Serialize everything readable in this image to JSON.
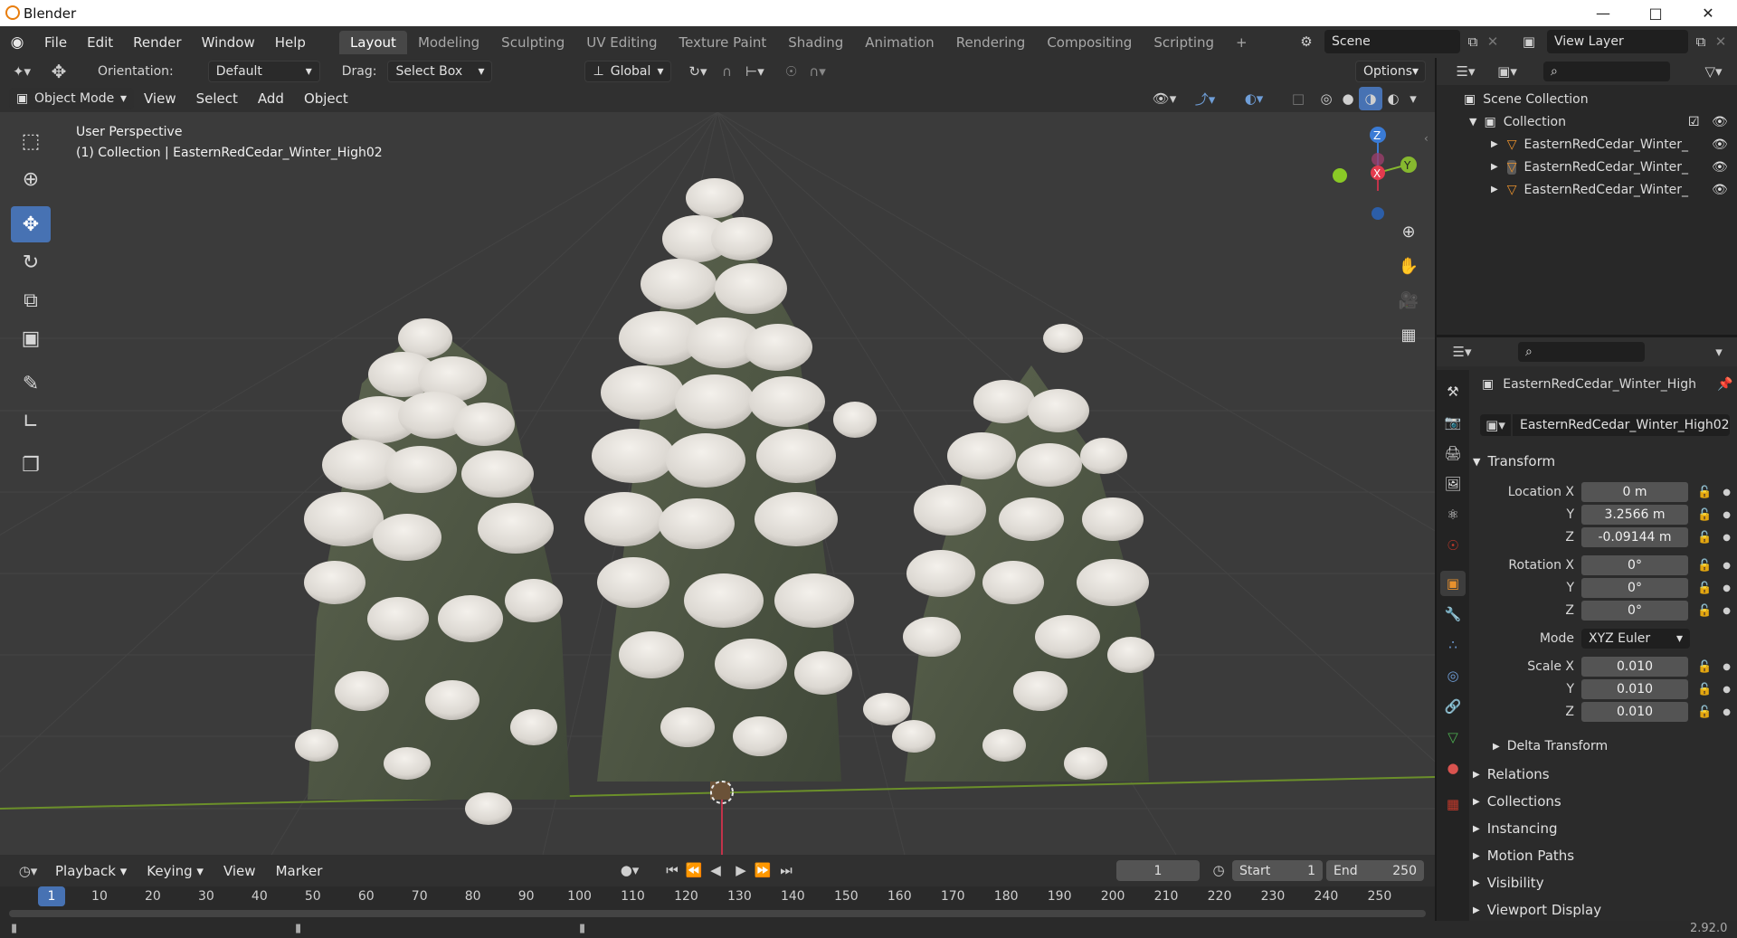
{
  "window": {
    "title": "Blender",
    "buttons": {
      "minimize": "—",
      "maximize": "□",
      "close": "✕"
    }
  },
  "menu": [
    "File",
    "Edit",
    "Render",
    "Window",
    "Help"
  ],
  "workspaces": [
    "Layout",
    "Modeling",
    "Sculpting",
    "UV Editing",
    "Texture Paint",
    "Shading",
    "Animation",
    "Rendering",
    "Compositing",
    "Scripting"
  ],
  "workspace_add": "+",
  "scene": {
    "name": "Scene",
    "view_layer": "View Layer"
  },
  "tool_header": {
    "orientation_label": "Orientation:",
    "orientation_value": "Default",
    "drag_label": "Drag:",
    "drag_value": "Select Box",
    "transform_orientation": "Global",
    "options": "Options"
  },
  "viewport_header": {
    "mode": "Object Mode",
    "menus": [
      "View",
      "Select",
      "Add",
      "Object"
    ]
  },
  "viewport": {
    "perspective": "User Perspective",
    "collection_info": "(1) Collection | EasternRedCedar_Winter_High02",
    "gizmo": {
      "x": "X",
      "y": "Y",
      "z": "Z"
    }
  },
  "outliner": {
    "scene_collection": "Scene Collection",
    "collection": "Collection",
    "objects": [
      "EasternRedCedar_Winter_",
      "EasternRedCedar_Winter_",
      "EasternRedCedar_Winter_"
    ]
  },
  "properties": {
    "object_name": "EasternRedCedar_Winter_High",
    "data_name": "EasternRedCedar_Winter_High02",
    "transform_title": "Transform",
    "location": {
      "label_x": "Location X",
      "x": "0 m",
      "y": "3.2566 m",
      "z": "-0.09144 m"
    },
    "rotation": {
      "label_x": "Rotation X",
      "x": "0°",
      "y": "0°",
      "z": "0°"
    },
    "mode_label": "Mode",
    "mode_value": "XYZ Euler",
    "scale": {
      "label_x": "Scale X",
      "x": "0.010",
      "y": "0.010",
      "z": "0.010"
    },
    "axis_y": "Y",
    "axis_z": "Z",
    "delta_transform": "Delta Transform",
    "sections": [
      "Relations",
      "Collections",
      "Instancing",
      "Motion Paths",
      "Visibility",
      "Viewport Display"
    ]
  },
  "timeline": {
    "menus": [
      "Playback",
      "Keying",
      "View",
      "Marker"
    ],
    "current_frame": "1",
    "start_label": "Start",
    "start": "1",
    "end_label": "End",
    "end": "250",
    "ticks": [
      "1",
      "10",
      "20",
      "30",
      "40",
      "50",
      "60",
      "70",
      "80",
      "90",
      "100",
      "110",
      "120",
      "130",
      "140",
      "150",
      "160",
      "170",
      "180",
      "190",
      "200",
      "210",
      "220",
      "230",
      "240",
      "250"
    ]
  },
  "status": {
    "version": "2.92.0"
  }
}
